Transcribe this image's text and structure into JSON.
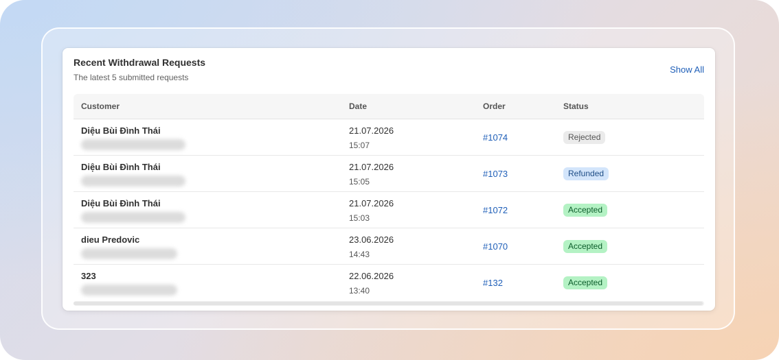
{
  "card": {
    "title": "Recent Withdrawal Requests",
    "subtitle": "The latest 5 submitted requests",
    "show_all_label": "Show All"
  },
  "table": {
    "headers": {
      "customer": "Customer",
      "date": "Date",
      "order": "Order",
      "status": "Status"
    },
    "rows": [
      {
        "name": "Diệu Bùi Đình Thái",
        "date": "21.07.2026",
        "time": "15:07",
        "order": "#1074",
        "status": "Rejected",
        "status_kind": "rejected"
      },
      {
        "name": "Diệu Bùi Đình Thái",
        "date": "21.07.2026",
        "time": "15:05",
        "order": "#1073",
        "status": "Refunded",
        "status_kind": "refunded"
      },
      {
        "name": "Diệu Bùi Đình Thái",
        "date": "21.07.2026",
        "time": "15:03",
        "order": "#1072",
        "status": "Accepted",
        "status_kind": "accepted"
      },
      {
        "name": "dieu Predovic",
        "date": "23.06.2026",
        "time": "14:43",
        "order": "#1070",
        "status": "Accepted",
        "status_kind": "accepted"
      },
      {
        "name": "323",
        "date": "22.06.2026",
        "time": "13:40",
        "order": "#132",
        "status": "Accepted",
        "status_kind": "accepted"
      }
    ]
  },
  "colors": {
    "link": "#1f5fb8",
    "badge_rejected_bg": "#ebebeb",
    "badge_refunded_bg": "#d3e5fb",
    "badge_accepted_bg": "#b4f2c4"
  }
}
